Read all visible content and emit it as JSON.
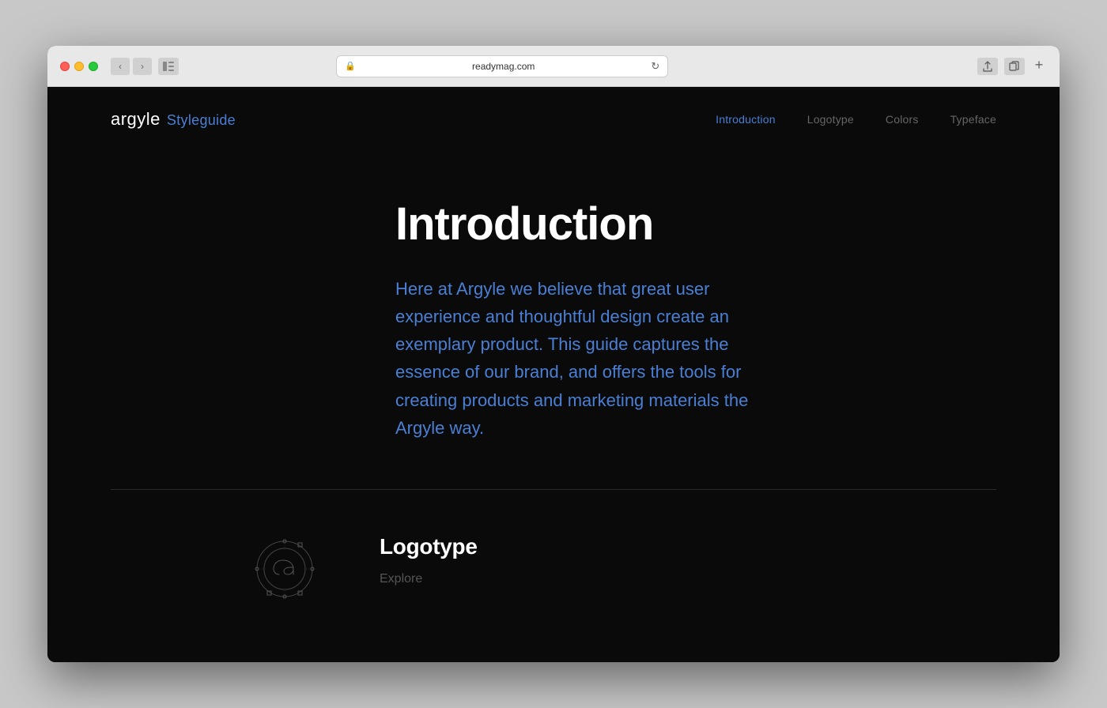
{
  "browser": {
    "url": "readymag.com",
    "traffic_lights": [
      "red",
      "yellow",
      "green"
    ]
  },
  "site": {
    "logo": {
      "brand": "argyle",
      "subtitle": "Styleguide"
    },
    "nav": {
      "items": [
        {
          "id": "introduction",
          "label": "Introduction",
          "active": true
        },
        {
          "id": "logotype",
          "label": "Logotype",
          "active": false
        },
        {
          "id": "colors",
          "label": "Colors",
          "active": false
        },
        {
          "id": "typeface",
          "label": "Typeface",
          "active": false
        }
      ]
    }
  },
  "main": {
    "intro": {
      "title": "Introduction",
      "body": "Here at Argyle we believe that great user experience and thoughtful design create an exemplary product. This guide captures the essence of our brand, and offers the tools for creating products and marketing materials the Argyle way."
    },
    "logotype": {
      "title": "Logotype",
      "explore_label": "Explore"
    }
  },
  "colors": {
    "accent": "#4a7fd4",
    "background": "#0a0a0a",
    "text_white": "#ffffff",
    "text_dim": "#555555"
  }
}
